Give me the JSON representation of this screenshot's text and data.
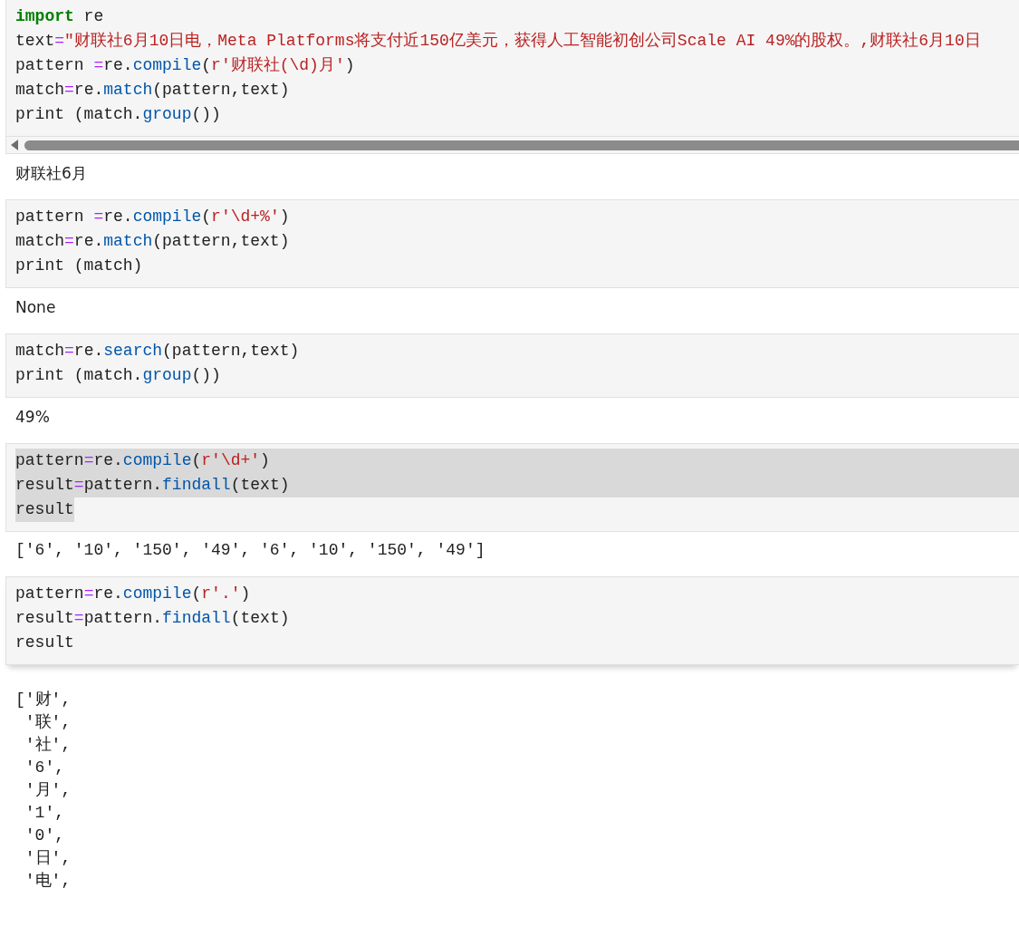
{
  "cells": [
    {
      "code": [
        {
          "tokens": [
            {
              "kind": "keyword",
              "text": "import"
            },
            {
              "kind": "plain",
              "text": " re"
            }
          ]
        },
        {
          "tokens": [
            {
              "kind": "plain",
              "text": "text"
            },
            {
              "kind": "operator",
              "text": "="
            },
            {
              "kind": "string",
              "text": "\"财联社6月10日电，Meta Platforms将支付近150亿美元，获得人工智能初创公司Scale AI 49%的股权。,财联社6月10日"
            }
          ]
        },
        {
          "tokens": [
            {
              "kind": "plain",
              "text": "pattern "
            },
            {
              "kind": "operator",
              "text": "="
            },
            {
              "kind": "plain",
              "text": "re."
            },
            {
              "kind": "function",
              "text": "compile"
            },
            {
              "kind": "plain",
              "text": "("
            },
            {
              "kind": "string",
              "text": "r'财联社(\\d)月'"
            },
            {
              "kind": "plain",
              "text": ")"
            }
          ]
        },
        {
          "tokens": [
            {
              "kind": "plain",
              "text": "match"
            },
            {
              "kind": "operator",
              "text": "="
            },
            {
              "kind": "plain",
              "text": "re."
            },
            {
              "kind": "function",
              "text": "match"
            },
            {
              "kind": "plain",
              "text": "(pattern,text)"
            }
          ]
        },
        {
          "tokens": [
            {
              "kind": "plain",
              "text": "print (match."
            },
            {
              "kind": "function",
              "text": "group"
            },
            {
              "kind": "plain",
              "text": "())"
            }
          ]
        }
      ],
      "scrollbar": true,
      "output": {
        "kind": "text",
        "lines": [
          "财联社6月"
        ]
      }
    },
    {
      "code": [
        {
          "tokens": [
            {
              "kind": "plain",
              "text": "pattern "
            },
            {
              "kind": "operator",
              "text": "="
            },
            {
              "kind": "plain",
              "text": "re."
            },
            {
              "kind": "function",
              "text": "compile"
            },
            {
              "kind": "plain",
              "text": "("
            },
            {
              "kind": "string",
              "text": "r'\\d+%'"
            },
            {
              "kind": "plain",
              "text": ")"
            }
          ]
        },
        {
          "tokens": [
            {
              "kind": "plain",
              "text": "match"
            },
            {
              "kind": "operator",
              "text": "="
            },
            {
              "kind": "plain",
              "text": "re."
            },
            {
              "kind": "function",
              "text": "match"
            },
            {
              "kind": "plain",
              "text": "(pattern,text)"
            }
          ]
        },
        {
          "tokens": [
            {
              "kind": "plain",
              "text": "print (match)"
            }
          ]
        }
      ],
      "output": {
        "kind": "text",
        "lines": [
          "None"
        ]
      }
    },
    {
      "code": [
        {
          "tokens": [
            {
              "kind": "plain",
              "text": "match"
            },
            {
              "kind": "operator",
              "text": "="
            },
            {
              "kind": "plain",
              "text": "re."
            },
            {
              "kind": "function",
              "text": "search"
            },
            {
              "kind": "plain",
              "text": "(pattern,text)"
            }
          ]
        },
        {
          "tokens": [
            {
              "kind": "plain",
              "text": "print (match."
            },
            {
              "kind": "function",
              "text": "group"
            },
            {
              "kind": "plain",
              "text": "())"
            }
          ]
        }
      ],
      "output": {
        "kind": "text",
        "lines": [
          "49%"
        ]
      }
    },
    {
      "code": [
        {
          "selected": true,
          "tokens": [
            {
              "kind": "plain",
              "text": "pattern"
            },
            {
              "kind": "operator",
              "text": "="
            },
            {
              "kind": "plain",
              "text": "re."
            },
            {
              "kind": "function",
              "text": "compile"
            },
            {
              "kind": "plain",
              "text": "("
            },
            {
              "kind": "string",
              "text": "r'\\d+'"
            },
            {
              "kind": "plain",
              "text": ")"
            }
          ]
        },
        {
          "selected": true,
          "tokens": [
            {
              "kind": "plain",
              "text": "result"
            },
            {
              "kind": "operator",
              "text": "="
            },
            {
              "kind": "plain",
              "text": "pattern."
            },
            {
              "kind": "function",
              "text": "findall"
            },
            {
              "kind": "plain",
              "text": "(text)"
            }
          ]
        },
        {
          "selected": true,
          "tokens": [
            {
              "kind": "plain",
              "text": "result"
            }
          ]
        }
      ],
      "output": {
        "kind": "mono",
        "lines": [
          "['6', '10', '150', '49', '6', '10', '150', '49']"
        ]
      }
    },
    {
      "code": [
        {
          "tokens": [
            {
              "kind": "plain",
              "text": "pattern"
            },
            {
              "kind": "operator",
              "text": "="
            },
            {
              "kind": "plain",
              "text": "re."
            },
            {
              "kind": "function",
              "text": "compile"
            },
            {
              "kind": "plain",
              "text": "("
            },
            {
              "kind": "string",
              "text": "r'.'"
            },
            {
              "kind": "plain",
              "text": ")"
            }
          ]
        },
        {
          "tokens": [
            {
              "kind": "plain",
              "text": "result"
            },
            {
              "kind": "operator",
              "text": "="
            },
            {
              "kind": "plain",
              "text": "pattern."
            },
            {
              "kind": "function",
              "text": "findall"
            },
            {
              "kind": "plain",
              "text": "(text)"
            }
          ]
        },
        {
          "tokens": [
            {
              "kind": "plain",
              "text": "result"
            }
          ]
        }
      ],
      "active": true,
      "output": {
        "kind": "mono",
        "lines": [
          "['财',",
          " '联',",
          " '社',",
          " '6',",
          " '月',",
          " '1',",
          " '0',",
          " '日',",
          " '电',"
        ]
      }
    }
  ]
}
